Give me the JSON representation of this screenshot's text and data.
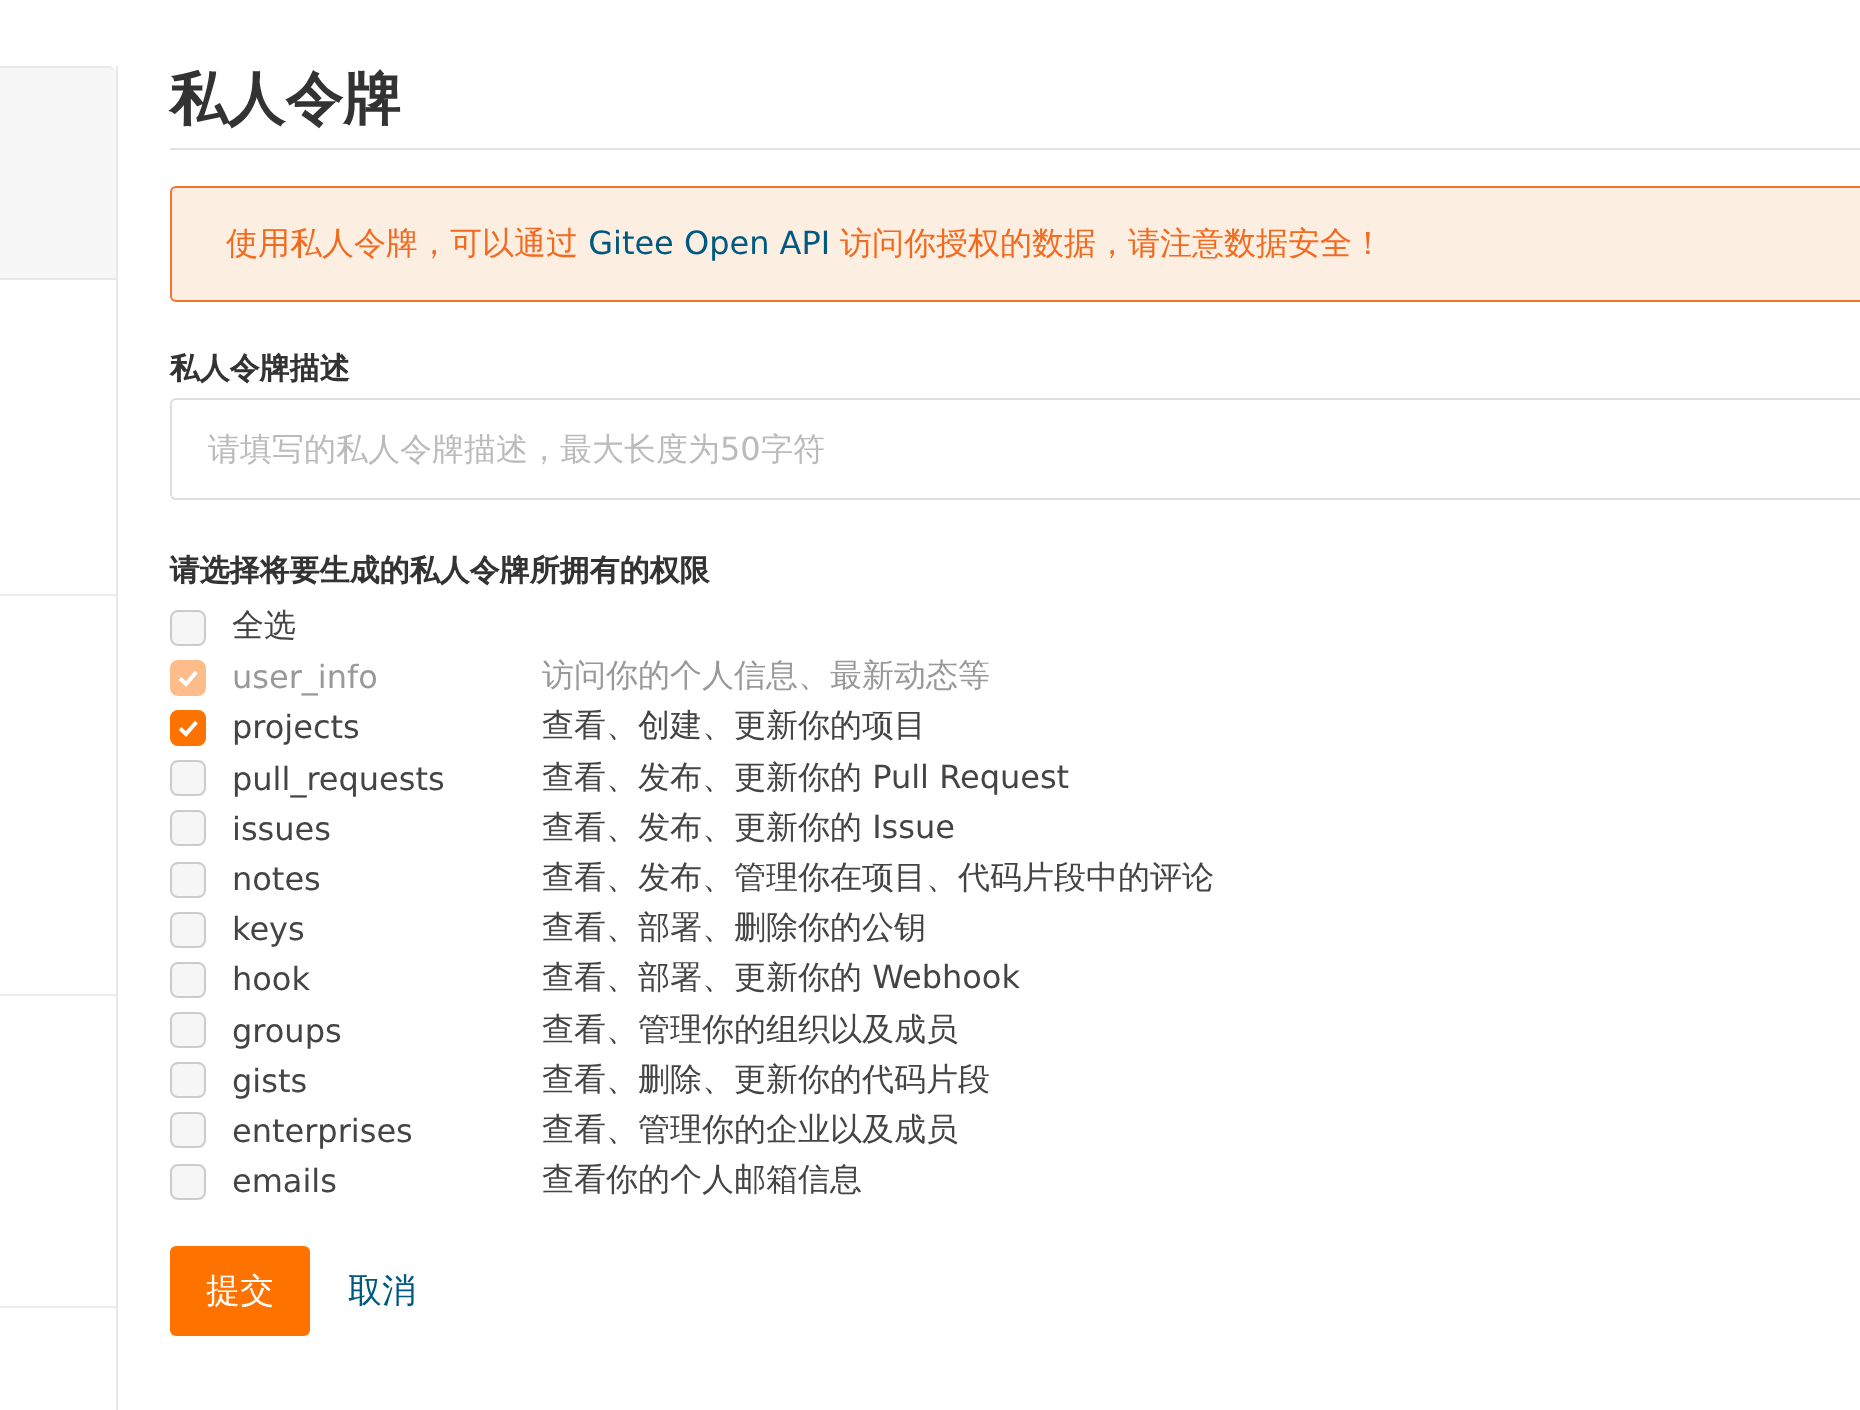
{
  "page": {
    "title": "私人令牌"
  },
  "notice": {
    "text_before": "使用私人令牌，可以通过 ",
    "link": "Gitee Open API",
    "text_after": " 访问你授权的数据，请注意数据安全！"
  },
  "description_field": {
    "label": "私人令牌描述",
    "placeholder": "请填写的私人令牌描述，最大长度为50字符"
  },
  "permissions": {
    "label": "请选择将要生成的私人令牌所拥有的权限",
    "select_all": {
      "label": "全选",
      "checked": false
    },
    "items": [
      {
        "name": "user_info",
        "description": "访问你的个人信息、最新动态等",
        "checked": true,
        "disabled": true
      },
      {
        "name": "projects",
        "description": "查看、创建、更新你的项目",
        "checked": true,
        "disabled": false
      },
      {
        "name": "pull_requests",
        "description": "查看、发布、更新你的 Pull Request",
        "checked": false,
        "disabled": false
      },
      {
        "name": "issues",
        "description": "查看、发布、更新你的 Issue",
        "checked": false,
        "disabled": false
      },
      {
        "name": "notes",
        "description": "查看、发布、管理你在项目、代码片段中的评论",
        "checked": false,
        "disabled": false
      },
      {
        "name": "keys",
        "description": "查看、部署、删除你的公钥",
        "checked": false,
        "disabled": false
      },
      {
        "name": "hook",
        "description": "查看、部署、更新你的 Webhook",
        "checked": false,
        "disabled": false
      },
      {
        "name": "groups",
        "description": "查看、管理你的组织以及成员",
        "checked": false,
        "disabled": false
      },
      {
        "name": "gists",
        "description": "查看、删除、更新你的代码片段",
        "checked": false,
        "disabled": false
      },
      {
        "name": "enterprises",
        "description": "查看、管理你的企业以及成员",
        "checked": false,
        "disabled": false
      },
      {
        "name": "emails",
        "description": "查看你的个人邮箱信息",
        "checked": false,
        "disabled": false
      }
    ]
  },
  "buttons": {
    "submit": "提交",
    "cancel": "取消"
  }
}
